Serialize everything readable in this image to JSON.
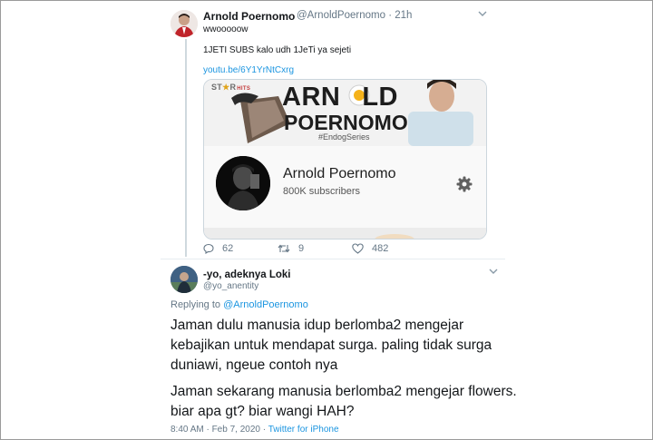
{
  "tweet1": {
    "name": "Arnold Poernomo",
    "handle": "@ArnoldPoernomo",
    "dot": "·",
    "time": "21h",
    "line1": "wwooooow",
    "line2": "1JETI SUBS kalo udh 1JeTi ya sejeti",
    "link": "youtu.be/6Y1YrNtCxrg",
    "card": {
      "brand_star": "ST",
      "brand_star_suffix": "R",
      "brand_hits": "HITS",
      "banner_line1_a": "ARN",
      "banner_line1_b": "LD",
      "banner_line2": "POERNOMO",
      "banner_tag": "#EndogSeries",
      "channel_name": "Arnold Poernomo",
      "subscribers": "800K subscribers"
    },
    "actions": {
      "replies": "62",
      "retweets": "9",
      "likes": "482"
    }
  },
  "tweet2": {
    "name": "-yo, adeknya Loki",
    "handle": "@yo_anentity",
    "replying_prefix": "Replying to",
    "replying_to": "@ArnoldPoernomo",
    "para1": [
      "Jaman dulu manusia idup berlomba2 mengejar",
      "kebajikan untuk mendapat surga. paling tidak surga",
      "duniawi, ngeue contoh nya"
    ],
    "para2": [
      "Jaman sekarang manusia berlomba2 mengejar flowers.",
      "biar apa gt? biar wangi HAH?"
    ],
    "timestamp": "8:40 AM · Feb 7, 2020",
    "sep": "·",
    "source": "Twitter for iPhone"
  },
  "colors": {
    "link": "#1b95e0",
    "muted": "#657786",
    "text": "#14171a"
  },
  "icons": [
    "reply-icon",
    "retweet-icon",
    "like-icon",
    "caret-down-icon",
    "gear-icon"
  ]
}
